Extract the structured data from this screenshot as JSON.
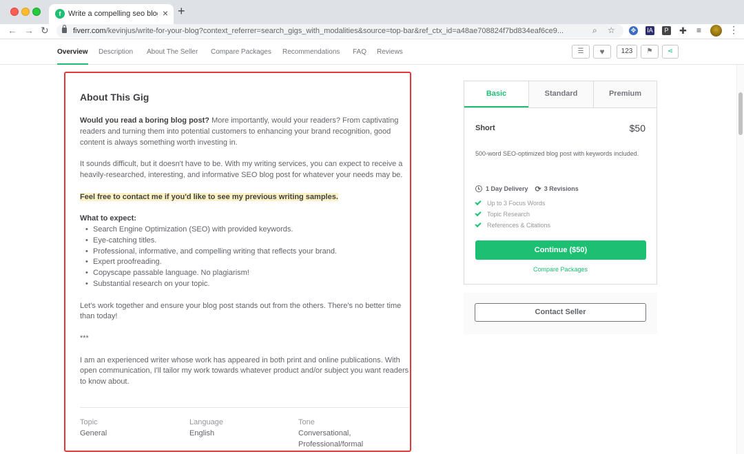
{
  "browser": {
    "tab_title": "Write a compelling seo blog post",
    "tab_favicon": "fiverr-favicon",
    "url_host": "fiverr.com",
    "url_path": "/kevinjus/write-for-your-blog?context_referrer=search_gigs_with_modalities&source=top-bar&ref_ctx_id=a48ae708824f7bd834eaf6ce9...",
    "new_tab_label": "+",
    "ext_labels": [
      "IA",
      "P"
    ]
  },
  "gig_nav": {
    "items": [
      "Overview",
      "Description",
      "About The Seller",
      "Compare Packages",
      "Recommendations",
      "FAQ",
      "Reviews"
    ],
    "like_count": "123"
  },
  "description": {
    "title": "About This Gig",
    "p1_bold": "Would you read a boring blog post?",
    "p1_rest": " More importantly, would your readers? From captivating readers and turning them into potential customers to enhancing your brand recognition, good content is always something worth investing in.",
    "p2": "It sounds difficult, but it doesn't have to be. With my writing services, you can expect to receive a heavily-researched, interesting, and informative SEO blog post for whatever your needs may be.",
    "p3_highlight": "Feel free to contact me if you'd like to see my previous writing samples.",
    "expect_heading": "What to expect:",
    "bullets": [
      "Search Engine Optimization (SEO) with provided keywords.",
      "Eye-catching titles.",
      "Professional, informative, and compelling writing that reflects your brand.",
      "Expert proofreading.",
      "Copyscape passable language. No plagiarism!",
      "Substantial research on your topic."
    ],
    "p4": "Let's work together and ensure your blog post stands out from the others. There's no better time than today!",
    "separator": "***",
    "p5": "I am an experienced writer whose work has appeared in both print and online publications. With open communication, I'll tailor my work towards whatever product and/or subject you want readers to know about.",
    "meta": [
      {
        "label": "Topic",
        "value": "General"
      },
      {
        "label": "Language",
        "value": "English"
      },
      {
        "label": "Tone",
        "value": "Conversational, Professional/formal"
      }
    ]
  },
  "package": {
    "tabs": [
      "Basic",
      "Standard",
      "Premium"
    ],
    "active_tab": "Basic",
    "name": "Short",
    "price": "$50",
    "desc": "500-word SEO-optimized blog post with keywords included.",
    "delivery": "1 Day Delivery",
    "revisions": "3 Revisions",
    "features": [
      "Up to 3 Focus Words",
      "Topic Research",
      "References & Citations"
    ],
    "continue_label": "Continue ($50)",
    "compare_label": "Compare Packages",
    "contact_label": "Contact Seller"
  },
  "colors": {
    "accent": "#1dbf73",
    "highlight_border": "#e23838"
  }
}
